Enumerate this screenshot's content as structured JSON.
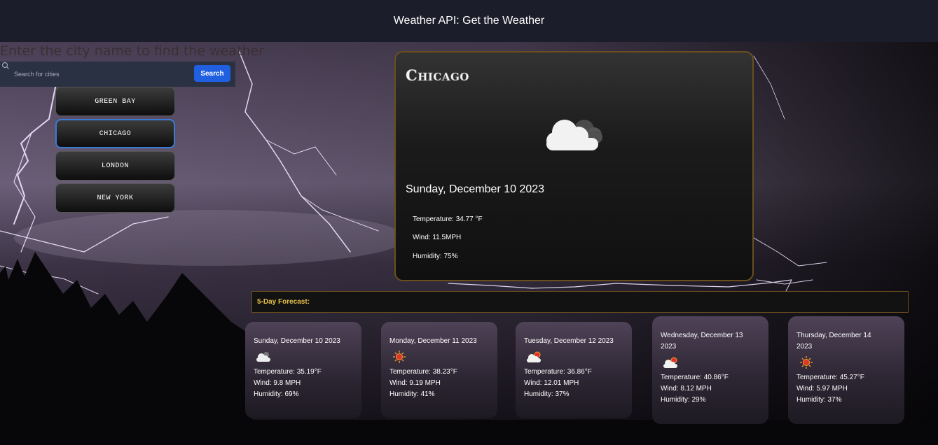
{
  "header": {
    "title": "Weather API: Get the Weather"
  },
  "search": {
    "prompt": "Enter the city name to find the weather",
    "placeholder": "Search for cities",
    "button_label": "Search"
  },
  "cities": [
    {
      "label": "GREEN BAY",
      "active": false
    },
    {
      "label": "CHICAGO",
      "active": true
    },
    {
      "label": "LONDON",
      "active": false
    },
    {
      "label": "NEW YORK",
      "active": false
    }
  ],
  "current": {
    "city": "Chicago",
    "icon": "cloud-icon",
    "date": "Sunday, December 10 2023",
    "temperature": "Temperature: 34.77 °F",
    "wind": "Wind: 11.5MPH",
    "humidity": "Humidity: 75%"
  },
  "forecast": {
    "title": "5-Day Forecast:",
    "days": [
      {
        "date": "Sunday, December 10 2023",
        "icon": "cloud-moon-icon",
        "temperature": "Temperature: 35.19°F",
        "wind": "Wind: 9.8 MPH",
        "humidity": "Humidity: 69%"
      },
      {
        "date": "Monday, December 11 2023",
        "icon": "sun-icon",
        "temperature": "Temperature: 38.23°F",
        "wind": "Wind: 9.19 MPH",
        "humidity": "Humidity: 41%"
      },
      {
        "date": "Tuesday, December 12 2023",
        "icon": "sun-cloud-icon",
        "temperature": "Temperature: 36.86°F",
        "wind": "Wind: 12.01 MPH",
        "humidity": "Humidity: 37%"
      },
      {
        "date": "Wednesday, December 13 2023",
        "icon": "sun-cloud-icon",
        "temperature": "Temperature: 40.86°F",
        "wind": "Wind: 8.12 MPH",
        "humidity": "Humidity: 29%"
      },
      {
        "date": "Thursday, December 14 2023",
        "icon": "sun-icon",
        "temperature": "Temperature: 45.27°F",
        "wind": "Wind: 5.97 MPH",
        "humidity": "Humidity: 37%"
      }
    ]
  },
  "colors": {
    "header_bg": "#1c1d2a",
    "accent_blue": "#1f5fe0",
    "forecast_title": "#e8c24a",
    "card_border": "#6b4e1e"
  }
}
